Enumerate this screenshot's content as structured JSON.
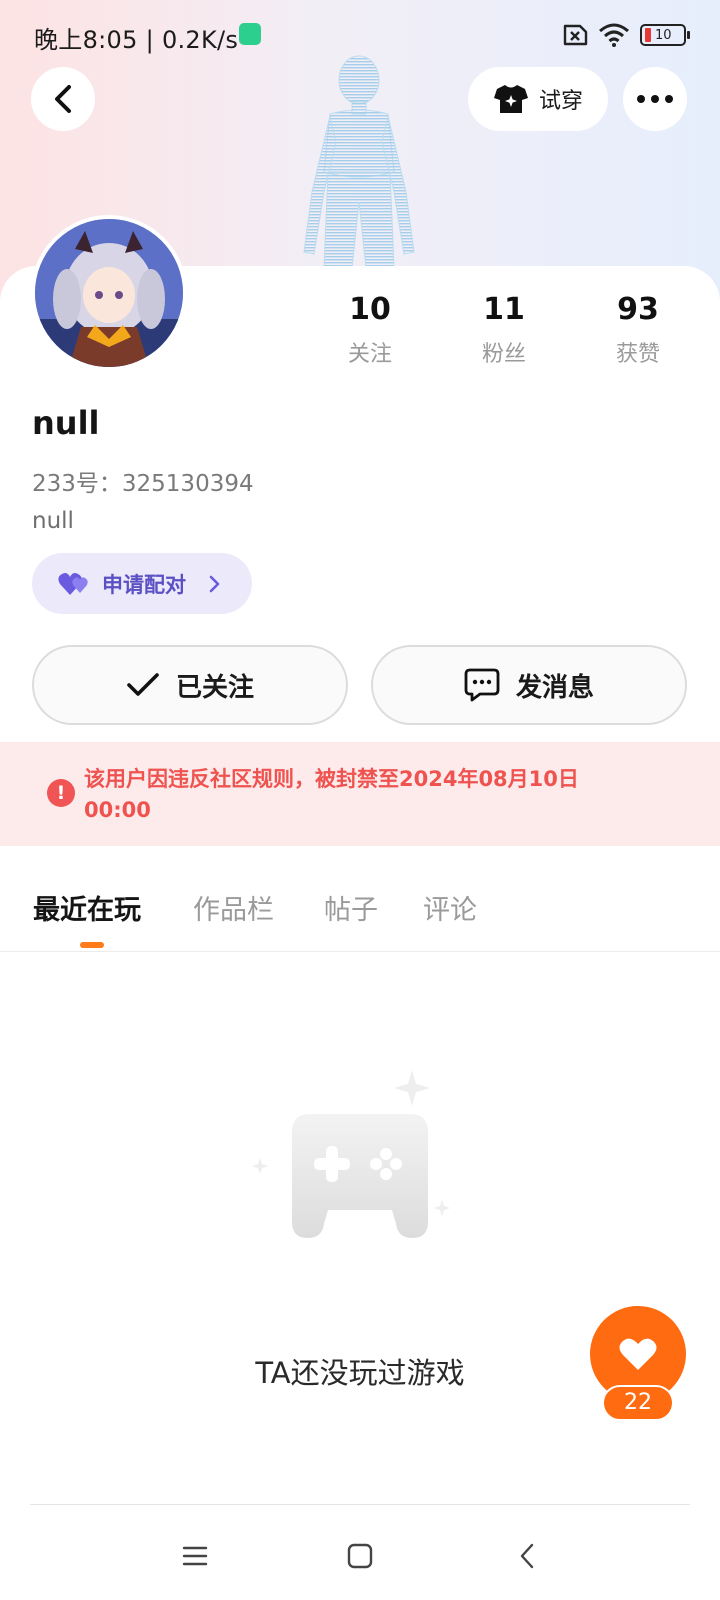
{
  "status_bar": {
    "time": "晚上8:05 | 0.2K/s",
    "battery": "10"
  },
  "header": {
    "tryon_label": "试穿"
  },
  "profile": {
    "username": "null",
    "user_id": "233号：325130394",
    "bio": "null",
    "pair_label": "申请配对"
  },
  "stats": [
    {
      "value": "10",
      "label": "关注"
    },
    {
      "value": "11",
      "label": "粉丝"
    },
    {
      "value": "93",
      "label": "获赞"
    }
  ],
  "actions": {
    "followed_label": "已关注",
    "message_label": "发消息"
  },
  "ban_notice": "该用户因违反社区规则，被封禁至2024年08月10日 00:00",
  "tabs": [
    {
      "label": "最近在玩",
      "active": true
    },
    {
      "label": "作品栏",
      "active": false
    },
    {
      "label": "帖子",
      "active": false
    },
    {
      "label": "评论",
      "active": false
    }
  ],
  "empty_state": {
    "text": "TA还没玩过游戏"
  },
  "like": {
    "count": "22"
  },
  "colors": {
    "accent": "#ff6b10",
    "ban_text": "#ef5350",
    "pair_text": "#5b51c4"
  }
}
